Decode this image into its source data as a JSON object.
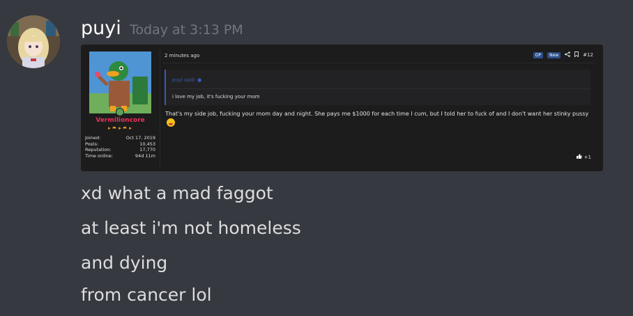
{
  "message": {
    "username": "puyi",
    "timestamp": "Today at 3:13 PM",
    "lines": [
      "xd what a mad faggot",
      "at least i'm not homeless",
      "and dying",
      "from cancer lol"
    ]
  },
  "attachment": {
    "poster": {
      "name": "Vermilioncore",
      "trophies": "⯈⯊⯈⯊⯈",
      "stats": [
        {
          "label": "Joined:",
          "value": "Oct 17, 2019"
        },
        {
          "label": "Posts:",
          "value": "10,453"
        },
        {
          "label": "Reputation:",
          "value": "17,770"
        },
        {
          "label": "Time online:",
          "value": "94d 11m"
        }
      ]
    },
    "post": {
      "time": "2 minutes ago",
      "badges": [
        "OP",
        "New"
      ],
      "share_icon": "share-icon",
      "bookmark_icon": "bookmark-icon",
      "post_number": "#12",
      "quote": {
        "author": "puyi said:",
        "text": "i love my job, it's fucking your mom"
      },
      "body": "That's my side job, fucking your mom day and night. She pays me $1000 for each time I cum, but I told her to fuck of and I don't want her stinky pussy",
      "reaction": "+1"
    }
  },
  "colors": {
    "background": "#36393f",
    "username": "#ffffff",
    "timestamp": "#72767d",
    "poster_name": "#e8345a",
    "badge": "#2d4f8a"
  }
}
